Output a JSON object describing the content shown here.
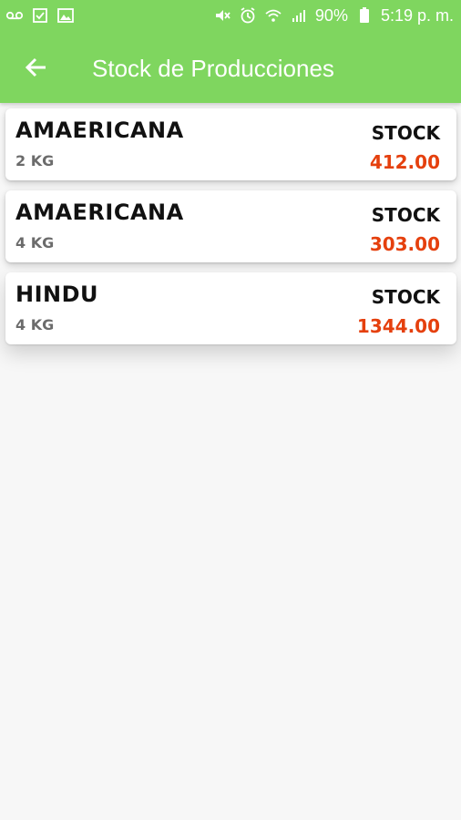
{
  "status_bar": {
    "battery": "90%",
    "time": "5:19 p. m."
  },
  "app_bar": {
    "title": "Stock de Producciones",
    "background_color": "#7fd65f"
  },
  "stock_value_color": "#e5400e",
  "items": [
    {
      "name": "AMAERICANA",
      "weight": "2 KG",
      "stock_label": "STOCK",
      "stock_value": "412.00"
    },
    {
      "name": "AMAERICANA",
      "weight": "4 KG",
      "stock_label": "STOCK",
      "stock_value": "303.00"
    },
    {
      "name": "HINDU",
      "weight": "4 KG",
      "stock_label": "STOCK",
      "stock_value": "1344.00"
    }
  ]
}
